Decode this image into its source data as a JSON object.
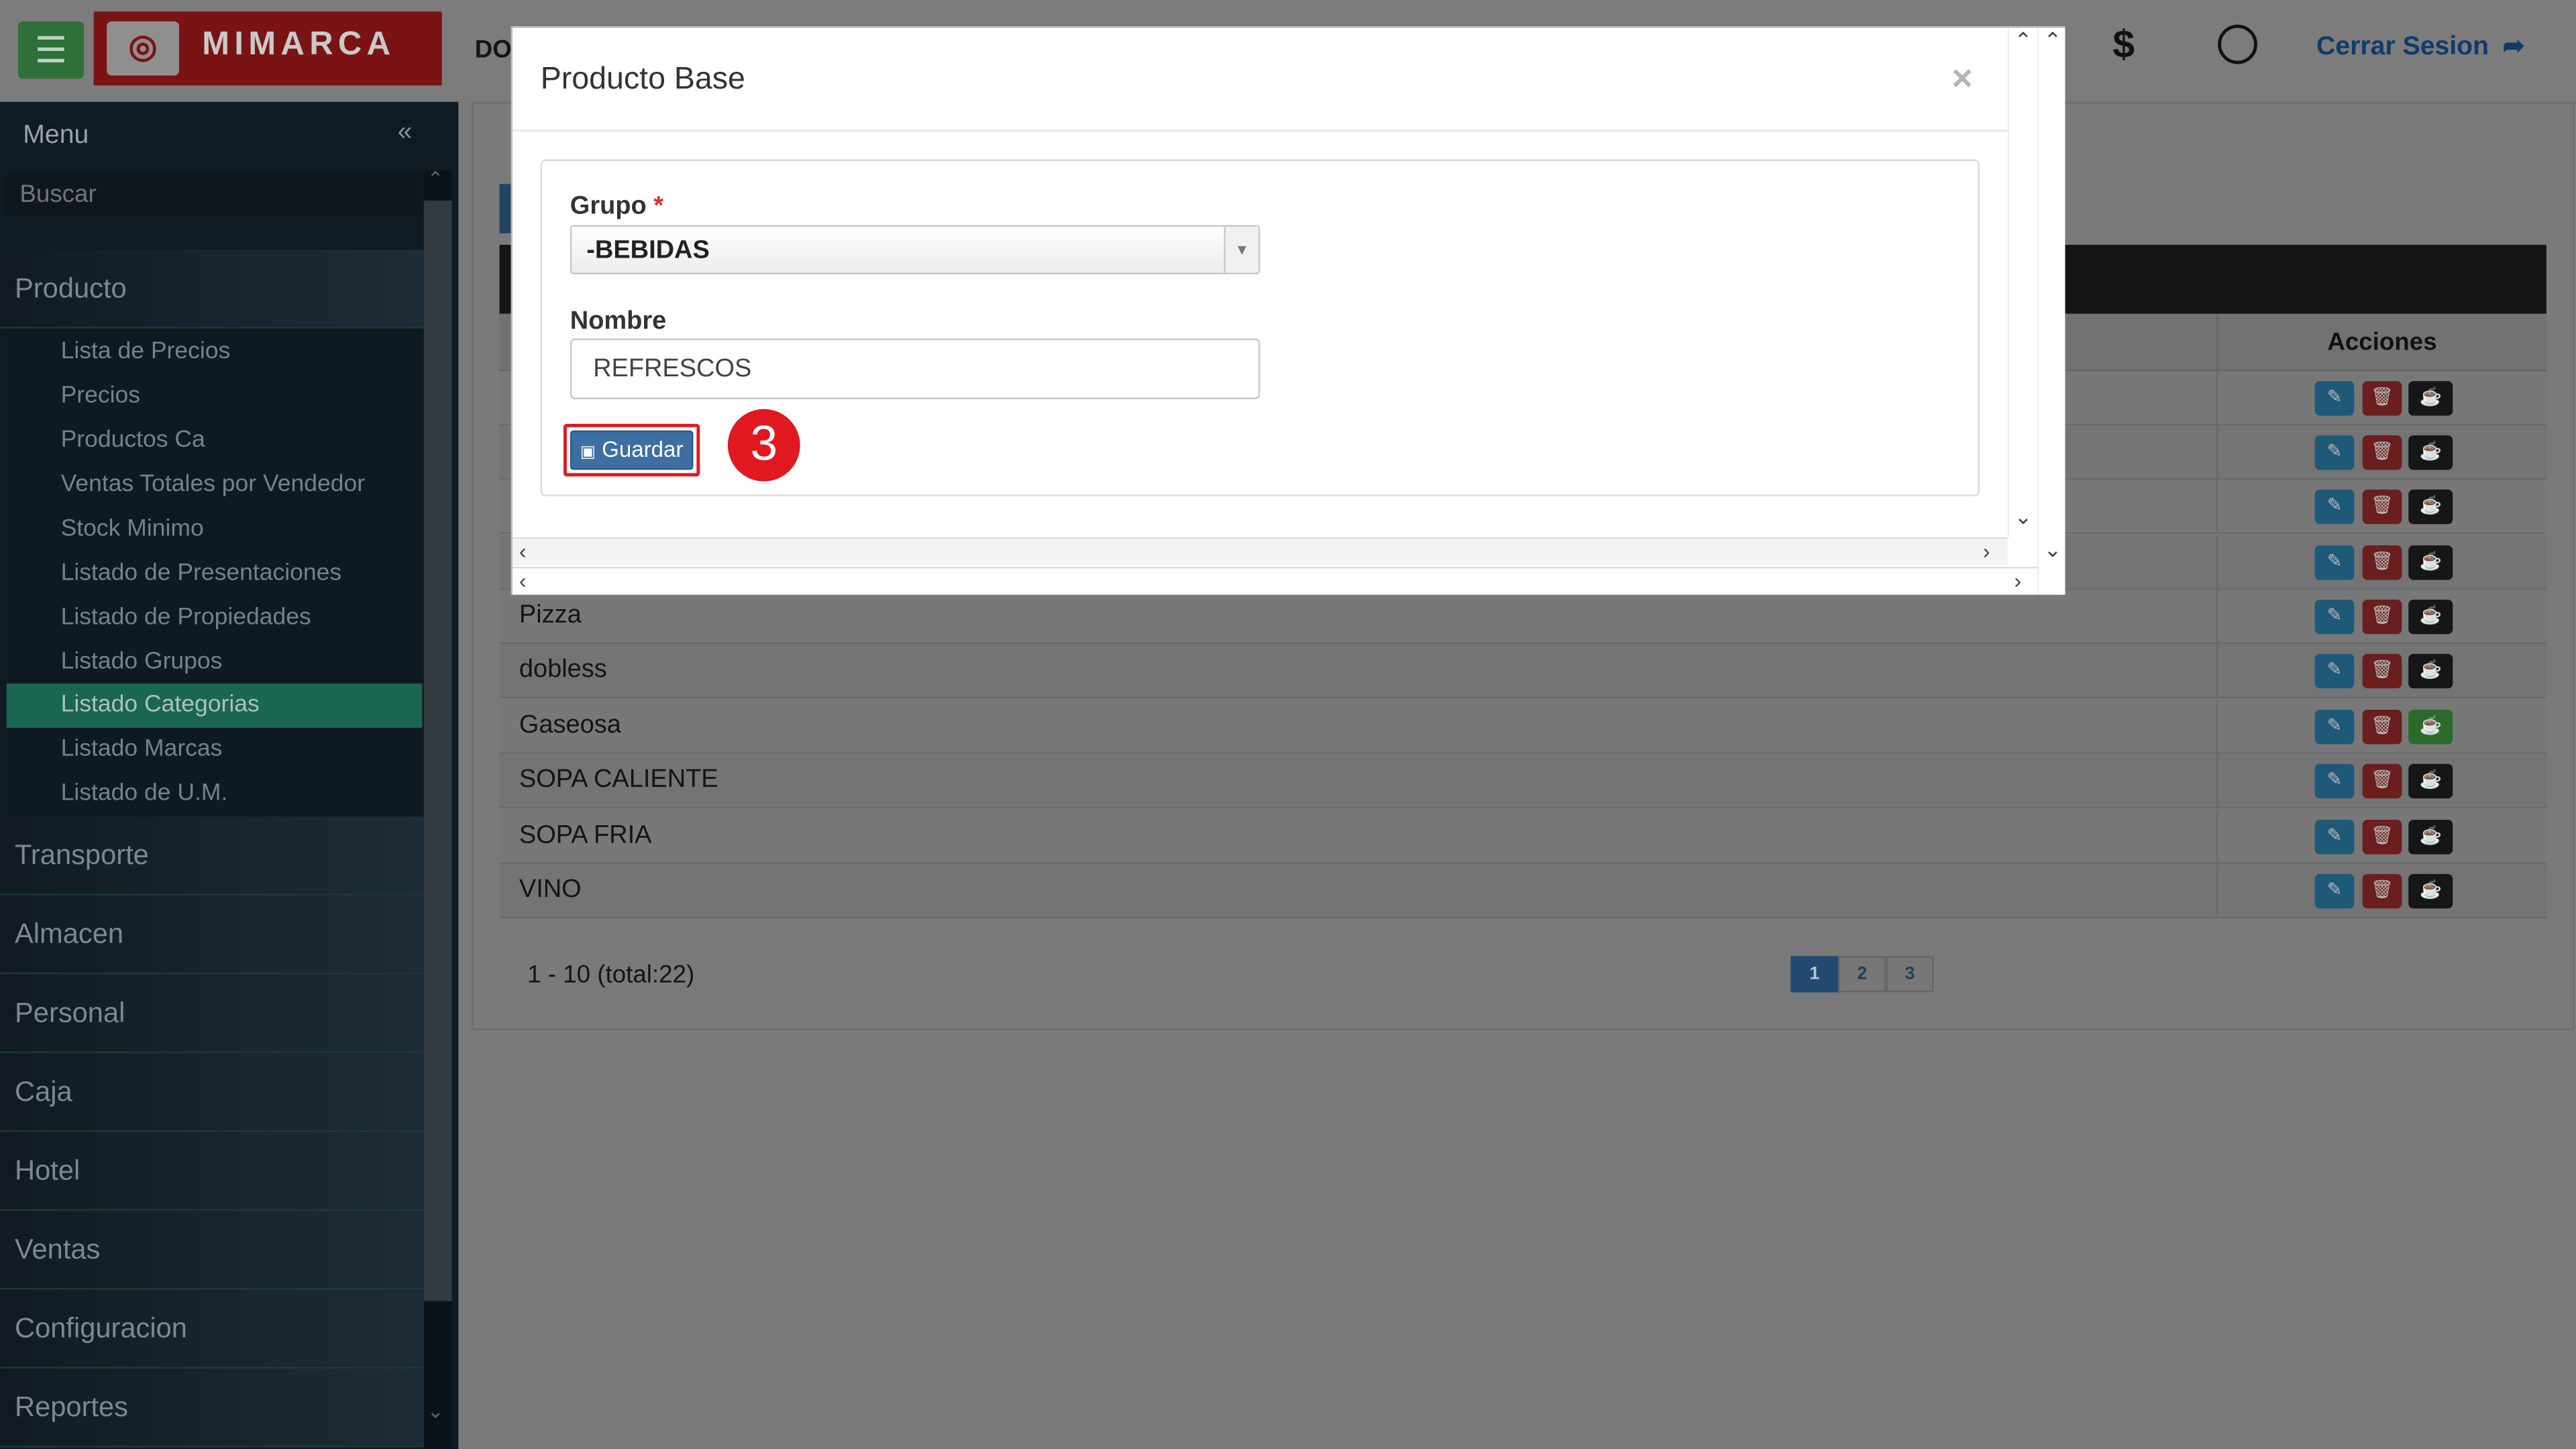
{
  "header": {
    "brand": "MIMARCA",
    "breadcrumb": "DO",
    "logout_label": "Cerrar Sesion"
  },
  "icons": {
    "hamburger": "☰",
    "logo_mark": "◎",
    "dollar": "$",
    "lock": "🔒",
    "logout": "➦",
    "collapse": "«",
    "close": "×",
    "save": "💾",
    "edit": "✎",
    "delete": "🗑",
    "cup": "☕"
  },
  "sidebar": {
    "menu_label": "Menu",
    "search_placeholder": "Buscar",
    "sections": [
      {
        "label": "Producto"
      },
      {
        "label": "Transporte"
      },
      {
        "label": "Almacen"
      },
      {
        "label": "Personal"
      },
      {
        "label": "Caja"
      },
      {
        "label": "Hotel"
      },
      {
        "label": "Ventas"
      },
      {
        "label": "Configuracion"
      },
      {
        "label": "Reportes"
      }
    ],
    "producto_items": [
      {
        "label": "Lista de Precios"
      },
      {
        "label": "Precios"
      },
      {
        "label": "Productos Ca"
      },
      {
        "label": "Ventas Totales por Vendedor"
      },
      {
        "label": "Stock Minimo"
      },
      {
        "label": "Listado de Presentaciones"
      },
      {
        "label": "Listado de Propiedades"
      },
      {
        "label": "Listado Grupos"
      },
      {
        "label": "Listado Categorias"
      },
      {
        "label": "Listado Marcas"
      },
      {
        "label": "Listado de U.M."
      }
    ],
    "active_item": "Listado Categorias"
  },
  "table": {
    "actions_header": "Acciones",
    "rows": [
      {
        "name": ""
      },
      {
        "name": ""
      },
      {
        "name": ""
      },
      {
        "name": ""
      },
      {
        "name": "Pizza"
      },
      {
        "name": "dobless"
      },
      {
        "name": "Gaseosa"
      },
      {
        "name": "SOPA CALIENTE"
      },
      {
        "name": "SOPA FRIA"
      },
      {
        "name": "VINO"
      }
    ],
    "pager_info": "1 - 10 (total:22)",
    "pages": [
      "1",
      "2",
      "3"
    ],
    "current_page": "1"
  },
  "modal": {
    "title": "Producto Base",
    "grupo_label": "Grupo",
    "required_mark": "*",
    "grupo_value": "-BEBIDAS",
    "nombre_label": "Nombre",
    "nombre_value": "REFRESCOS",
    "save_label": "Guardar",
    "step_number": "3"
  },
  "colors": {
    "highlight": "#e0181f",
    "active_sidebar": "#1a6650",
    "primary_button": "#3d6fa3"
  }
}
